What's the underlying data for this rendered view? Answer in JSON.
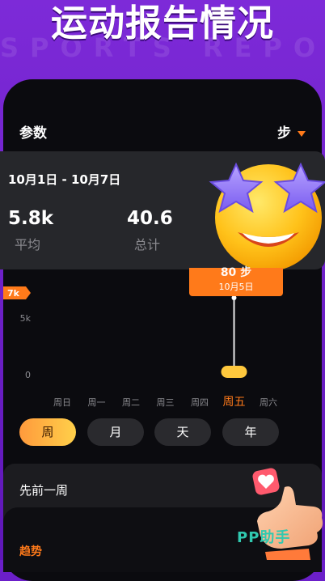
{
  "banner": {
    "title": "运动报告情况",
    "subtitle": "SPORTS REPORT"
  },
  "header": {
    "param_label": "参数",
    "unit": "步"
  },
  "summary": {
    "date_range": "10月1日 - 10月7日",
    "average": {
      "value": "5.8k",
      "label": "平均"
    },
    "total": {
      "value": "40.6",
      "label": "总计"
    }
  },
  "chart_data": {
    "type": "bar",
    "categories": [
      "周日",
      "周一",
      "周二",
      "周三",
      "周四",
      "周五",
      "周六"
    ],
    "y_ticks": [
      "0",
      "5k"
    ],
    "max_badge": "7k",
    "selected_index": 5,
    "tooltip": {
      "value": "80 步",
      "date": "10月5日"
    },
    "colors": {
      "accent": "#ff7a1a",
      "bar": "#ffc83d",
      "axis_label": "#8a8a8f"
    }
  },
  "period_tabs": [
    {
      "label": "周",
      "active": true
    },
    {
      "label": "月",
      "active": false
    },
    {
      "label": "天",
      "active": false
    },
    {
      "label": "年",
      "active": false
    }
  ],
  "previous": {
    "title": "先前一周"
  },
  "trend": {
    "title": "趋势"
  },
  "watermark": "PP助手",
  "icons": {
    "emoji": "star-eyes-emoji-icon",
    "hand": "thumbs-up-heart-icon"
  }
}
